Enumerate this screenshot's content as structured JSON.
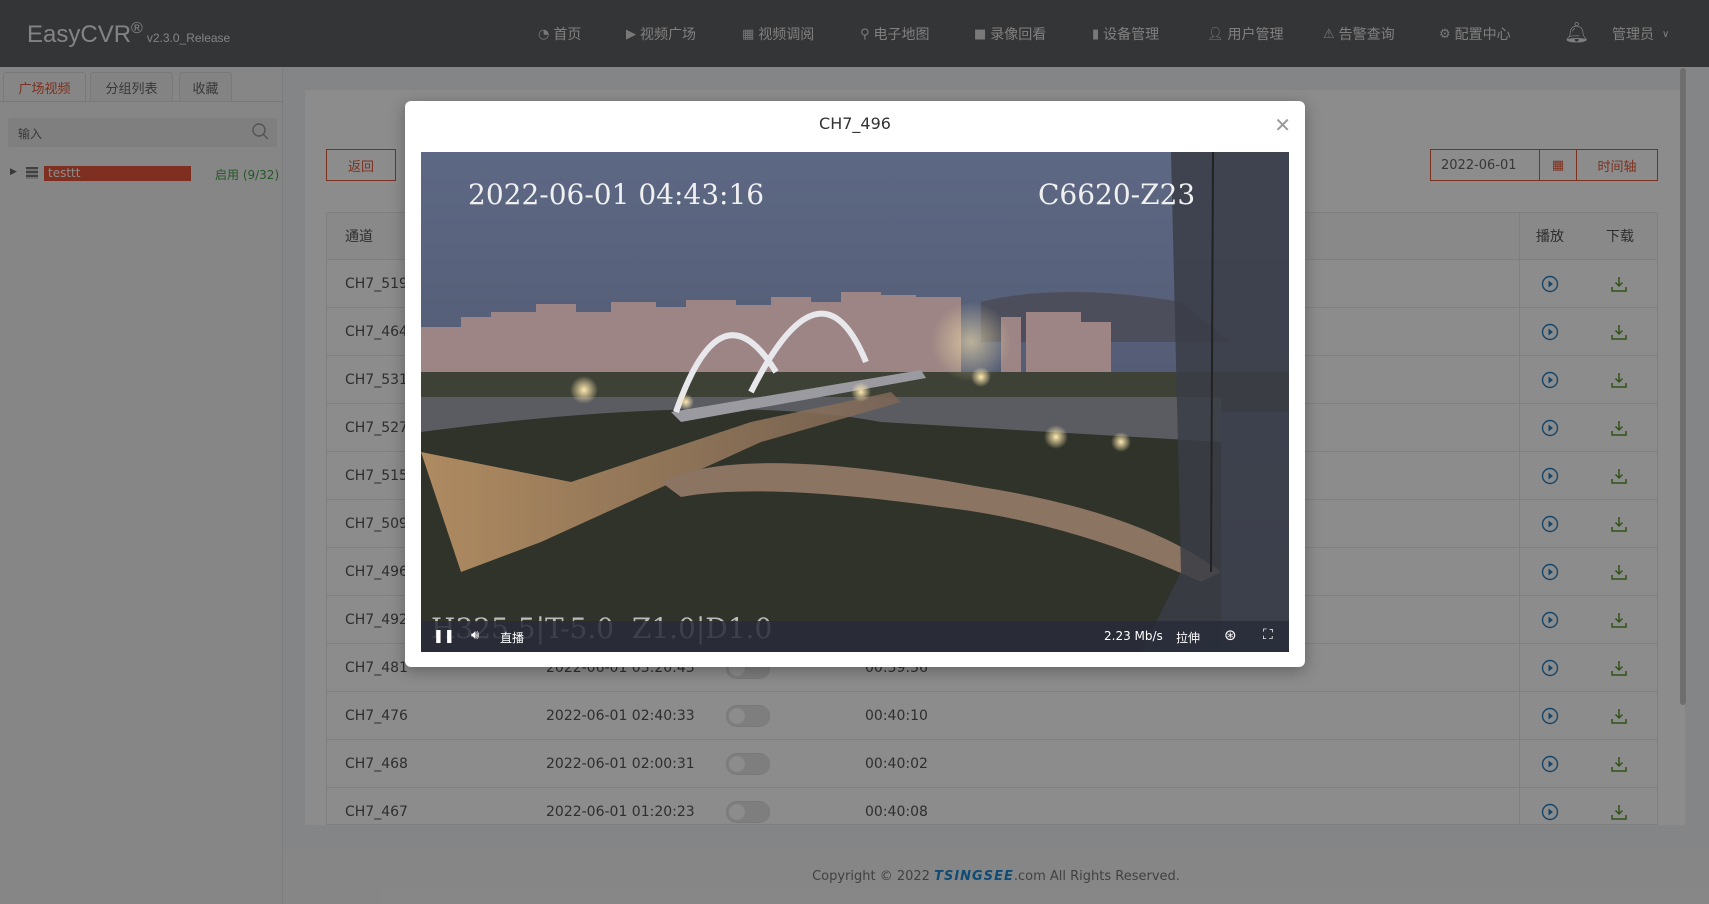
{
  "header": {
    "logo": "EasyCVR",
    "reg": "®",
    "version": "v2.3.0_Release",
    "nav": [
      {
        "label": "首页",
        "icon": "dashboard-icon"
      },
      {
        "label": "视频广场",
        "icon": "play-circle-icon"
      },
      {
        "label": "视频调阅",
        "icon": "layout-icon"
      },
      {
        "label": "电子地图",
        "icon": "map-pin-icon"
      },
      {
        "label": "录像回看",
        "icon": "video-camera-icon"
      },
      {
        "label": "设备管理",
        "icon": "server-icon"
      },
      {
        "label": "用户管理",
        "icon": "user-icon"
      },
      {
        "label": "告警查询",
        "icon": "alarm-icon"
      },
      {
        "label": "配置中心",
        "icon": "gear-icon"
      }
    ],
    "user": "管理员"
  },
  "sidebar": {
    "tabs": [
      "广场视频",
      "分组列表",
      "收藏"
    ],
    "search_placeholder": "输入",
    "tree": {
      "label": "testtt",
      "status": "启用 (9/32)"
    }
  },
  "toolbar": {
    "back": "返回",
    "date": "2022-06-01",
    "timeline": "时间轴"
  },
  "table": {
    "headers": {
      "channel": "通道",
      "play": "播放",
      "download": "下载"
    },
    "rows": [
      {
        "channel": "CH7_519"
      },
      {
        "channel": "CH7_464"
      },
      {
        "channel": "CH7_531"
      },
      {
        "channel": "CH7_527"
      },
      {
        "channel": "CH7_515"
      },
      {
        "channel": "CH7_509"
      },
      {
        "channel": "CH7_496"
      },
      {
        "channel": "CH7_492"
      },
      {
        "channel": "CH7_481",
        "time": "2022-06-01 03:20:43",
        "duration": "00:39:56"
      },
      {
        "channel": "CH7_476",
        "time": "2022-06-01 02:40:33",
        "duration": "00:40:10"
      },
      {
        "channel": "CH7_468",
        "time": "2022-06-01 02:00:31",
        "duration": "00:40:02"
      },
      {
        "channel": "CH7_467",
        "time": "2022-06-01 01:20:23",
        "duration": "00:40:08"
      }
    ]
  },
  "modal": {
    "title": "CH7_496",
    "osd": {
      "datetime": "2022-06-01 04:43:16",
      "camera": "C6620-Z23",
      "ptz": "H325.5|T-5.0  Z1.0|D1.0"
    },
    "controls": {
      "live": "直播",
      "bitrate": "2.23 Mb/s",
      "stretch": "拉伸"
    }
  },
  "footer": {
    "prefix": "Copyright © 2022 ",
    "brand": "TSINGSEE",
    "suffix": ".com All Rights Reserved."
  },
  "colors": {
    "accent": "#e05a3a",
    "status_green": "#43a047",
    "play_blue": "#2a7fc0",
    "download_green": "#5c9a2e"
  }
}
